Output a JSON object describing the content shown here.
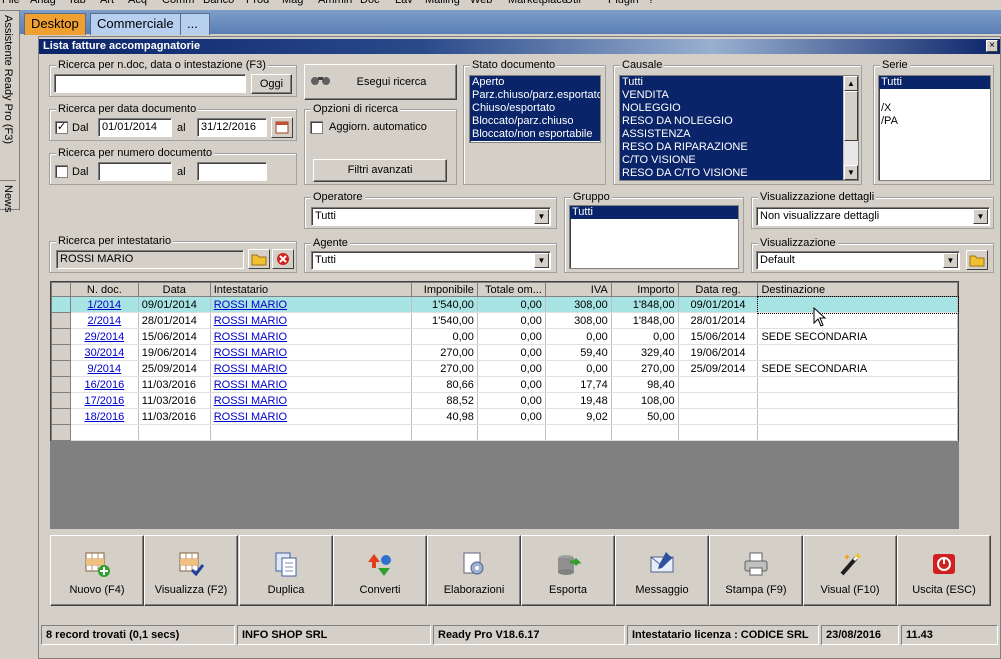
{
  "menu": [
    "File",
    "Anag",
    "Tab",
    "Art",
    "Acq",
    "Comm",
    "Banco",
    "Prod",
    "Mag",
    "Ammin",
    "Doc",
    "Lav",
    "Mailing",
    "Web",
    "Marketplace",
    "Util",
    "Plugin",
    "?"
  ],
  "sidebar": {
    "assistant": "Assistente Ready Pro (F3)",
    "news": "News"
  },
  "tabs": [
    {
      "label": "Desktop"
    },
    {
      "label": "Commerciale"
    },
    {
      "label": "..."
    }
  ],
  "window": {
    "title": "Lista fatture accompagnatorie",
    "close": "×"
  },
  "search_text": {
    "legend": "Ricerca per n.doc, data o intestazione (F3)",
    "value": "",
    "today_button": "Oggi"
  },
  "search_button": "Esegui ricerca",
  "date_search": {
    "legend": "Ricerca per data documento",
    "checked": true,
    "check_mark": "✓",
    "from_label": "Dal",
    "from": "01/01/2014",
    "to_label": "al",
    "to": "31/12/2016"
  },
  "number_search": {
    "legend": "Ricerca per numero documento",
    "from_label": "Dal",
    "to_label": "al",
    "from": "",
    "to": ""
  },
  "options": {
    "legend": "Opzioni di ricerca",
    "auto_update": "Aggiorn. automatico",
    "advanced_filters": "Filtri avanzati"
  },
  "stato": {
    "legend": "Stato documento",
    "items": [
      "Aperto",
      "Parz.chiuso/parz.esportato",
      "Chiuso/esportato",
      "Bloccato/parz.chiuso",
      "Bloccato/non esportabile"
    ]
  },
  "causale": {
    "legend": "Causale",
    "items": [
      "Tutti",
      "VENDITA",
      "NOLEGGIO",
      "RESO DA NOLEGGIO",
      "ASSISTENZA",
      "RESO DA RIPARAZIONE",
      "C/TO VISIONE",
      "RESO DA C/TO VISIONE"
    ]
  },
  "serie": {
    "legend": "Serie",
    "items": [
      "Tutti",
      "",
      "/X",
      "/PA"
    ]
  },
  "operatore": {
    "legend": "Operatore",
    "value": "Tutti"
  },
  "agente": {
    "legend": "Agente",
    "value": "Tutti"
  },
  "gruppo": {
    "legend": "Gruppo",
    "items": [
      "Tutti"
    ]
  },
  "dettagli": {
    "legend": "Visualizzazione dettagli",
    "value": "Non visualizzare dettagli"
  },
  "visualizzazione": {
    "legend": "Visualizzazione",
    "value": "Default"
  },
  "intestatario": {
    "legend": "Ricerca per intestatario",
    "value": "ROSSI MARIO"
  },
  "table": {
    "columns": [
      "N. doc.",
      "Data",
      "Intestatario",
      "Imponibile",
      "Totale om...",
      "IVA",
      "Importo",
      "Data reg.",
      "Destinazione"
    ],
    "rows": [
      [
        "1/2014",
        "09/01/2014",
        "ROSSI MARIO",
        "1'540,00",
        "0,00",
        "308,00",
        "1'848,00",
        "09/01/2014",
        ""
      ],
      [
        "2/2014",
        "28/01/2014",
        "ROSSI MARIO",
        "1'540,00",
        "0,00",
        "308,00",
        "1'848,00",
        "28/01/2014",
        ""
      ],
      [
        "29/2014",
        "15/06/2014",
        "ROSSI MARIO",
        "0,00",
        "0,00",
        "0,00",
        "0,00",
        "15/06/2014",
        "SEDE SECONDARIA"
      ],
      [
        "30/2014",
        "19/06/2014",
        "ROSSI MARIO",
        "270,00",
        "0,00",
        "59,40",
        "329,40",
        "19/06/2014",
        ""
      ],
      [
        "9/2014",
        "25/09/2014",
        "ROSSI MARIO",
        "270,00",
        "0,00",
        "0,00",
        "270,00",
        "25/09/2014",
        "SEDE SECONDARIA"
      ],
      [
        "16/2016",
        "11/03/2016",
        "ROSSI MARIO",
        "80,66",
        "0,00",
        "17,74",
        "98,40",
        "",
        ""
      ],
      [
        "17/2016",
        "11/03/2016",
        "ROSSI MARIO",
        "88,52",
        "0,00",
        "19,48",
        "108,00",
        "",
        ""
      ],
      [
        "18/2016",
        "11/03/2016",
        "ROSSI MARIO",
        "40,98",
        "0,00",
        "9,02",
        "50,00",
        "",
        ""
      ]
    ]
  },
  "actions": [
    {
      "label": "Nuovo (F4)",
      "icon": "new-grid-icon"
    },
    {
      "label": "Visualizza (F2)",
      "icon": "view-grid-icon"
    },
    {
      "label": "Duplica",
      "icon": "duplicate-icon"
    },
    {
      "label": "Converti",
      "icon": "convert-icon"
    },
    {
      "label": "Elaborazioni",
      "icon": "process-icon"
    },
    {
      "label": "Esporta",
      "icon": "export-icon"
    },
    {
      "label": "Messaggio",
      "icon": "message-icon"
    },
    {
      "label": "Stampa (F9)",
      "icon": "print-icon"
    },
    {
      "label": "Visual (F10)",
      "icon": "magic-wand-icon"
    },
    {
      "label": "Uscita (ESC)",
      "icon": "exit-icon"
    }
  ],
  "status": {
    "records": "8 record trovati (0,1 secs)",
    "company": "INFO SHOP SRL",
    "version": "Ready Pro V18.6.17",
    "license": "Intestatario licenza : CODICE SRL",
    "date": "23/08/2016",
    "time": "11.43"
  }
}
